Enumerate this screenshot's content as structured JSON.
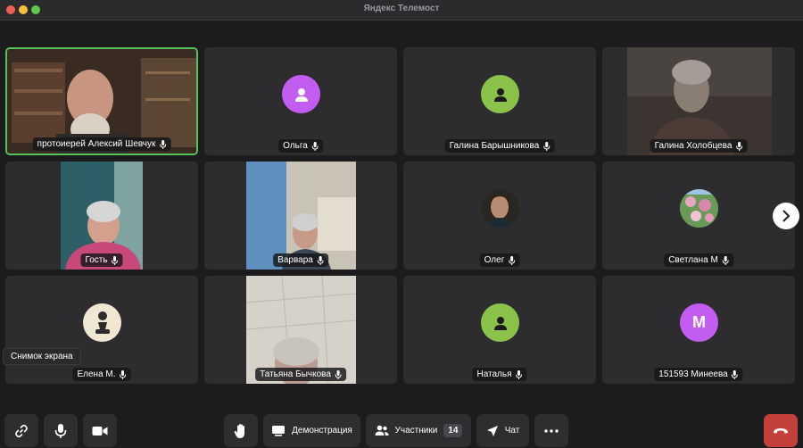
{
  "window": {
    "title": "Яндекс Телемост"
  },
  "participants": [
    {
      "name": "протоиерей Алексий Шевчук",
      "type": "video"
    },
    {
      "name": "Ольга",
      "type": "avatar",
      "avatar_color": "#c35cf0"
    },
    {
      "name": "Галина Барышникова",
      "type": "avatar",
      "avatar_color": "#8bc34a"
    },
    {
      "name": "Галина Холобцева",
      "type": "video"
    },
    {
      "name": "Гость",
      "type": "video"
    },
    {
      "name": "Варвара",
      "type": "video"
    },
    {
      "name": "Олег",
      "type": "photo"
    },
    {
      "name": "Светлана М",
      "type": "photo"
    },
    {
      "name": "Елена М.",
      "type": "photo"
    },
    {
      "name": "Татьяна Бычкова",
      "type": "video"
    },
    {
      "name": "Наталья",
      "type": "avatar",
      "avatar_color": "#8bc34a"
    },
    {
      "name": "151593 Минеева",
      "type": "letter",
      "letter": "М",
      "avatar_color": "#c35cf0"
    }
  ],
  "tooltip": {
    "text": "Снимок экрана"
  },
  "toolbar": {
    "screen_share_label": "Демонстрация",
    "participants_label": "Участники",
    "participants_count": "14",
    "chat_label": "Чат"
  },
  "colors": {
    "active_speaker": "#56c25a",
    "hangup": "#c4403a",
    "tile_bg": "#2d2d30"
  }
}
